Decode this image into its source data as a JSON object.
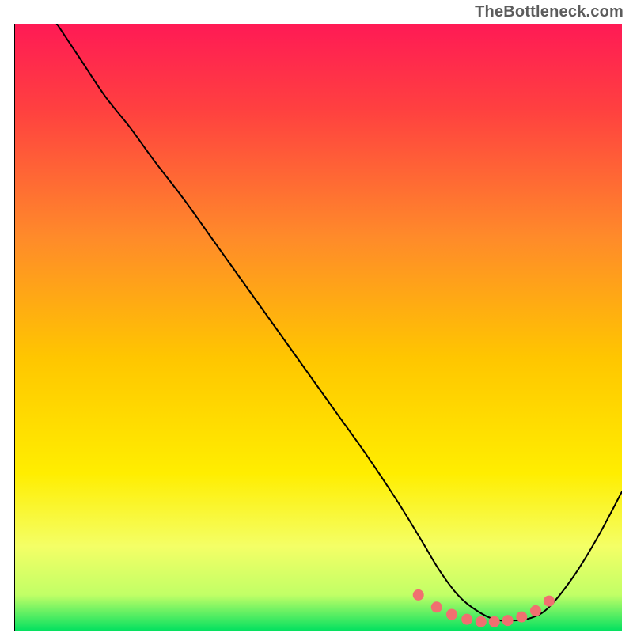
{
  "attribution": "TheBottleneck.com",
  "chart_data": {
    "type": "line",
    "title": "",
    "xlabel": "",
    "ylabel": "",
    "xlim": [
      0,
      1
    ],
    "ylim": [
      0,
      1
    ],
    "background": {
      "kind": "vertical-gradient",
      "stops": [
        {
          "pos": 0.0,
          "color": "#ff1a55"
        },
        {
          "pos": 0.14,
          "color": "#ff4040"
        },
        {
          "pos": 0.35,
          "color": "#ff8a2a"
        },
        {
          "pos": 0.55,
          "color": "#ffc600"
        },
        {
          "pos": 0.74,
          "color": "#ffee00"
        },
        {
          "pos": 0.86,
          "color": "#f4ff66"
        },
        {
          "pos": 0.94,
          "color": "#c1ff66"
        },
        {
          "pos": 1.0,
          "color": "#00e060"
        }
      ]
    },
    "series": [
      {
        "name": "bottleneck-curve",
        "color": "#000000",
        "width": 2,
        "x": [
          0.07,
          0.11,
          0.15,
          0.19,
          0.23,
          0.28,
          0.33,
          0.38,
          0.43,
          0.48,
          0.53,
          0.58,
          0.63,
          0.67,
          0.7,
          0.73,
          0.76,
          0.79,
          0.82,
          0.85,
          0.88,
          0.92,
          0.96,
          1.0
        ],
        "y": [
          1.0,
          0.94,
          0.88,
          0.83,
          0.775,
          0.71,
          0.64,
          0.57,
          0.5,
          0.43,
          0.36,
          0.29,
          0.215,
          0.15,
          0.1,
          0.06,
          0.035,
          0.02,
          0.018,
          0.022,
          0.04,
          0.09,
          0.155,
          0.23
        ]
      }
    ],
    "annotations": [
      {
        "name": "bottom-markers",
        "type": "scatter",
        "color": "#f07070",
        "radius": 7,
        "x": [
          0.665,
          0.695,
          0.72,
          0.745,
          0.768,
          0.79,
          0.812,
          0.835,
          0.858,
          0.88
        ],
        "y": [
          0.06,
          0.04,
          0.028,
          0.02,
          0.016,
          0.016,
          0.018,
          0.024,
          0.034,
          0.05
        ]
      }
    ],
    "axes": {
      "show_ticks": false,
      "show_grid": false,
      "border_color": "#000000",
      "border_sides": [
        "left",
        "bottom"
      ]
    }
  }
}
